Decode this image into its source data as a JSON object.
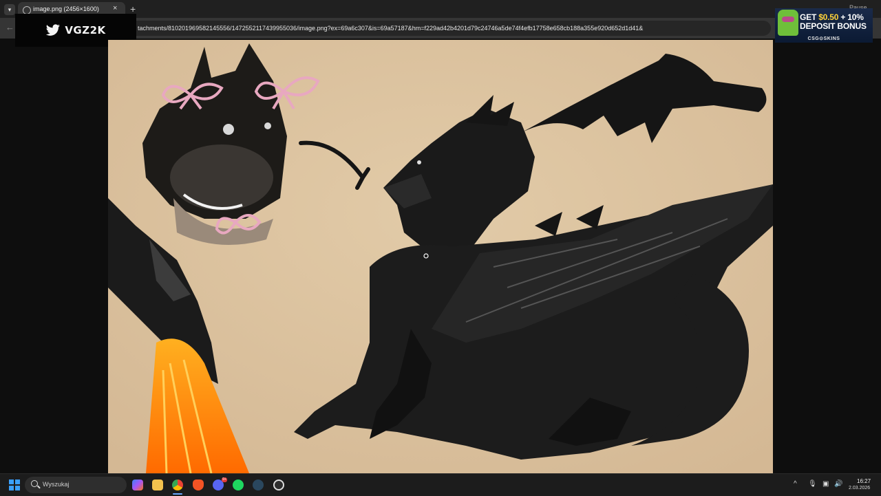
{
  "browser": {
    "tab_title": "image.png (2456×1600)",
    "new_tab_label": "+",
    "close_label": "×",
    "top_right_text": "Pause",
    "url": "tachments/810201969582145556/1472552117439955036/image.png?ex=69a6c307&is=69a57187&hm=f229ad42b4201d79c24746a5de74f4efb17758e658cb188a355e920d652d1d41&"
  },
  "overlays": {
    "streamer_logo_text": "VGZ2K",
    "promo_line1_prefix": "GET ",
    "promo_amount": "$0.50",
    "promo_line1_suffix": " + 10%",
    "promo_line2": "DEPOSIT BONUS",
    "promo_brand": "CSG⊙SKINS",
    "promo_accent": "#ffd23a"
  },
  "viewer": {
    "image_background": "#dcc3a0",
    "ink_color": "#141414"
  },
  "taskbar": {
    "search_placeholder": "Wyszukaj",
    "pinned_apps": [
      "copilot-icon",
      "file-explorer-icon",
      "chrome-icon",
      "brave-icon",
      "discord-icon",
      "spotify-icon",
      "steam-icon",
      "obs-icon"
    ],
    "discord_badge": "9+",
    "tray_chevron": "^",
    "clock_time": "16:27",
    "clock_date": "2.03.2026"
  }
}
